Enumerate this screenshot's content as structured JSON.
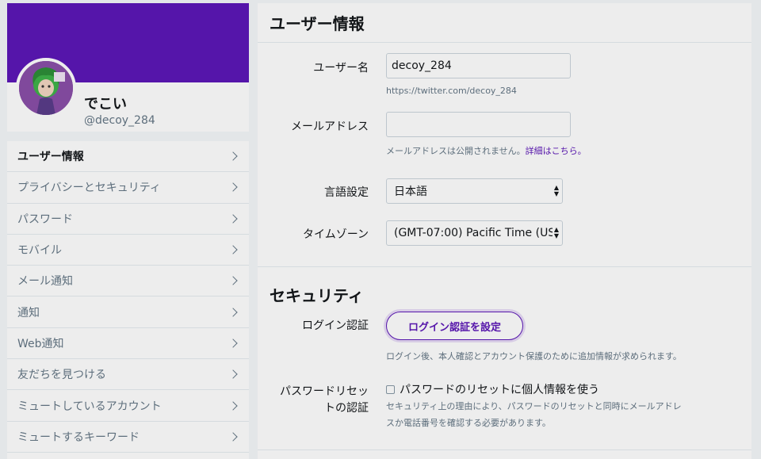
{
  "profile": {
    "name": "でこい",
    "handle": "@decoy_284",
    "banner_color": "#5c17b7"
  },
  "menu": {
    "items": [
      {
        "label": "ユーザー情報",
        "active": true
      },
      {
        "label": "プライバシーとセキュリティ"
      },
      {
        "label": "パスワード"
      },
      {
        "label": "モバイル"
      },
      {
        "label": "メール通知"
      },
      {
        "label": "通知"
      },
      {
        "label": "Web通知"
      },
      {
        "label": "友だちを見つける"
      },
      {
        "label": "ミュートしているアカウント"
      },
      {
        "label": "ミュートするキーワード"
      }
    ],
    "chevron_icon": "chevron-right-icon"
  },
  "account": {
    "title": "ユーザー情報",
    "username_label": "ユーザー名",
    "username_value": "decoy_284",
    "username_url": "https://twitter.com/decoy_284",
    "email_label": "メールアドレス",
    "email_value": "",
    "email_hint": "メールアドレスは公開されません。",
    "email_hint_link": "詳細はこちら。",
    "language_label": "言語設定",
    "language_value": "日本語",
    "timezone_label": "タイムゾーン",
    "timezone_value": "(GMT-07:00) Pacific Time (US"
  },
  "security": {
    "title": "セキュリティ",
    "login_verification_label": "ログイン認証",
    "login_verification_button": "ログイン認証を設定",
    "login_verification_desc": "ログイン後、本人確認とアカウント保護のために追加情報が求められます。",
    "password_reset_label_line1": "パスワードリセッ",
    "password_reset_label_line2": "トの認証",
    "password_reset_checkbox": "パスワードのリセットに個人情報を使う",
    "password_reset_checked": false,
    "password_reset_desc_line1": "セキュリティ上の理由により、パスワードのリセットと同時にメールアドレ",
    "password_reset_desc_line2": "スか電話番号を確認する必要があります。"
  },
  "colors": {
    "accent": "#5c17b7",
    "muted_text": "#657786",
    "border": "#e6ecf0"
  }
}
